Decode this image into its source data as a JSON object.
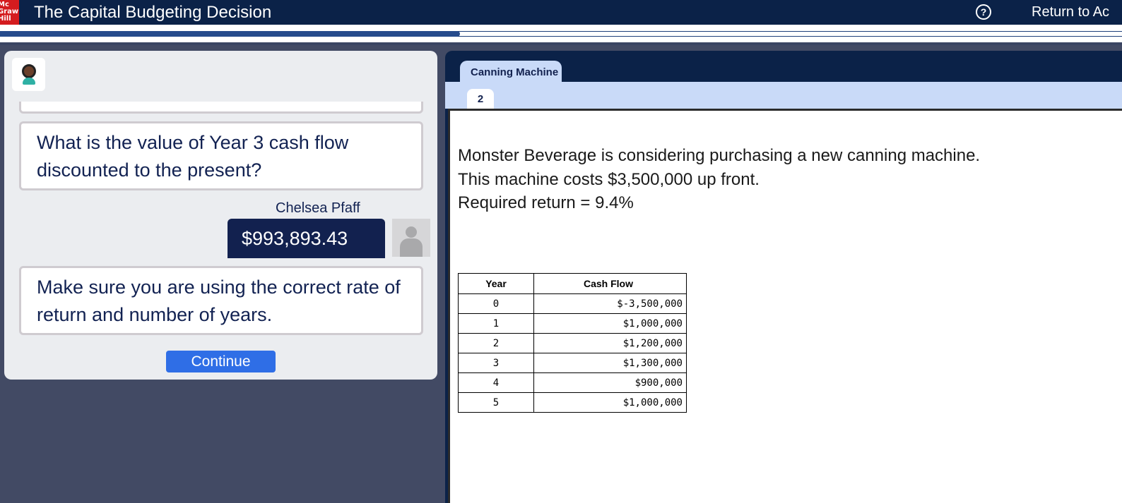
{
  "header": {
    "logo_lines": [
      "Mc",
      "Graw",
      "Hill"
    ],
    "title": "The Capital Budgeting Decision",
    "help_icon": "question-circle-icon",
    "return_label": "Return to Ac"
  },
  "progress": {
    "fraction": 0.41
  },
  "chat": {
    "agent_avatar_icon": "agent-avatar-icon",
    "question": "What is the value of Year 3 cash flow discounted to the present?",
    "user_name": "Chelsea Pfaff",
    "user_answer": "$993,893.43",
    "user_avatar_icon": "user-placeholder-icon",
    "feedback": "Make sure you are using the correct rate of return and number of years.",
    "continue_label": "Continue"
  },
  "workspace": {
    "tab_label": "Canning Machine",
    "subtab_label": "2",
    "intro_lines": [
      "Monster Beverage is considering purchasing a new canning machine.",
      "This machine costs $3,500,000 up front.",
      "Required return = 9.4%"
    ],
    "table": {
      "headers": [
        "Year",
        "Cash Flow"
      ],
      "rows": [
        [
          "0",
          "$-3,500,000"
        ],
        [
          "1",
          "$1,000,000"
        ],
        [
          "2",
          "$1,200,000"
        ],
        [
          "3",
          "$1,300,000"
        ],
        [
          "4",
          "$900,000"
        ],
        [
          "5",
          "$1,000,000"
        ]
      ]
    }
  },
  "colors": {
    "navy": "#0b2248",
    "panel_bg": "#424a64",
    "accent_blue": "#2f6ee6",
    "tab_light": "#c9daf8",
    "logo_red": "#d41c1f"
  }
}
